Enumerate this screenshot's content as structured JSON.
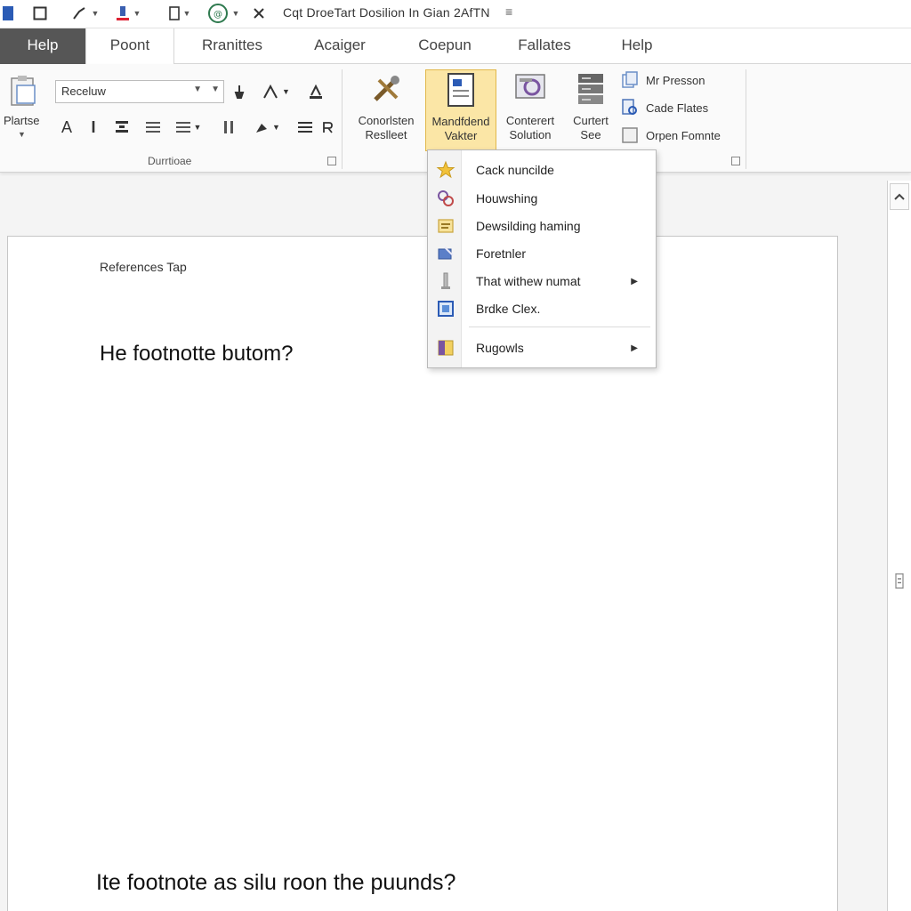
{
  "titlebar": {
    "title": "Cqt DroeTart Dosilion In Gian 2AfTN",
    "menu_glyph": "≡",
    "icons": [
      "word-icon",
      "new-doc-icon",
      "brush-icon",
      "highlight-color-icon",
      "box-icon",
      "globe-icon",
      "close-x-icon"
    ]
  },
  "tabs": [
    "Help",
    "Poont",
    "Rranittes",
    "Acaiger",
    "Coepun",
    "Fallates",
    "Help"
  ],
  "ribbon": {
    "paste_label": "Plartse",
    "font_name": "Receluw",
    "font_group_label": "Durrtioae",
    "big_buttons": [
      {
        "label1": "Conorlsten",
        "label2": "Reslleet"
      },
      {
        "label1": "Mandfdend",
        "label2": "Vakter"
      },
      {
        "label1": "Conterert",
        "label2": "Solution"
      },
      {
        "label1": "Curtert",
        "label2": "See"
      }
    ],
    "small_buttons": [
      "Mr Presson",
      "Cade Flates",
      "Orpen Fomnte"
    ]
  },
  "document": {
    "caption": "References Tap",
    "question1": "He footnotte butom?",
    "question2": "Ite footnote as silu roon the puunds?"
  },
  "menu": {
    "items": [
      {
        "label": "Cack nuncilde",
        "icon": "star-icon",
        "submenu": false
      },
      {
        "label": "Houwshing",
        "icon": "link-icon",
        "submenu": false
      },
      {
        "label": "Dewsilding haming",
        "icon": "note-icon",
        "submenu": false
      },
      {
        "label": "Foretnler",
        "icon": "edit-icon",
        "submenu": false
      },
      {
        "label": "That withew numat",
        "icon": "pencil-icon",
        "submenu": true
      },
      {
        "label": "Brdke Clex.",
        "icon": "frame-icon",
        "submenu": false
      },
      {
        "label": "Rugowls",
        "icon": "book-icon",
        "submenu": true
      }
    ]
  },
  "colors": {
    "dark_tab": "#565656",
    "highlight": "#fbe6a6",
    "highlight_border": "#e2b84b",
    "accent_blue": "#2b5bb5"
  }
}
